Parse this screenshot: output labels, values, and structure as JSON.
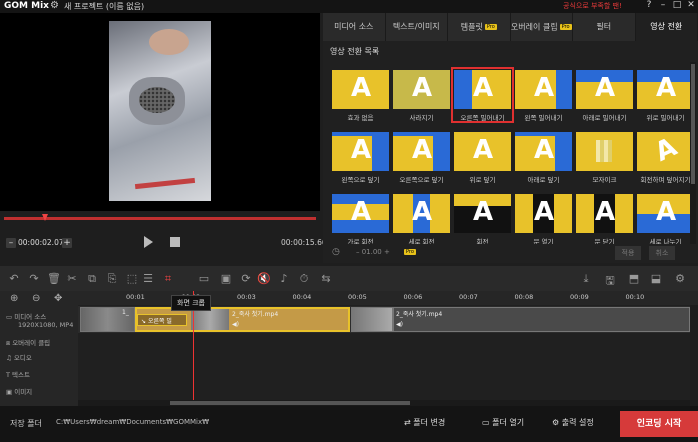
{
  "app": {
    "logo": "GOM Mix",
    "project_name": "새 프로젝트 (이름 없음)",
    "promo": "공식으로 부족할 땐!"
  },
  "window": {
    "help": "?",
    "minimize": "–",
    "maximize": "□",
    "close": "✕"
  },
  "preview": {
    "current_time": "00:00:02.07",
    "end_time": "00:00:15.66",
    "minus": "–",
    "plus": "+"
  },
  "tabs": [
    {
      "label": "미디어 소스",
      "pro": false
    },
    {
      "label": "텍스트/이미지",
      "pro": false
    },
    {
      "label": "템플릿",
      "pro": true
    },
    {
      "label": "오버레이 클립",
      "pro": true
    },
    {
      "label": "필터",
      "pro": false
    },
    {
      "label": "영상 전환",
      "pro": false,
      "active": true
    }
  ],
  "pro_badge": "Pro",
  "section_title": "영상 전환 목록",
  "transitions": [
    "효과 없음",
    "사라지기",
    "오른쪽 밀어내기",
    "왼쪽 밀어내기",
    "아래로 밀어내기",
    "위로 밀어내기",
    "왼쪽으로 덮기",
    "오른쪽으로 덮기",
    "위로 덮기",
    "아래로 덮기",
    "모자이크",
    "회전하며 덮어지기",
    "가로 회전",
    "세로 회전",
    "회전",
    "문 열기",
    "문 닫기",
    "세로 나누기"
  ],
  "transition_panel": {
    "time": "– 01.00 +",
    "apply": "적용",
    "cancel": "취소"
  },
  "timeline": {
    "tooltip": "화면 크롭",
    "ticks": [
      "00:01",
      "00:02",
      "00:03",
      "00:04",
      "00:05",
      "00:06",
      "00:07",
      "00:08",
      "00:09",
      "00:10"
    ],
    "tracks": [
      "미디어 소스",
      "1920X1080, MP4",
      "오버레이 클립",
      "오디오",
      "텍스트",
      "이미지"
    ],
    "clip1_label": "1_",
    "clip2_label": "2_죽사 첫기.mp4",
    "clip2_effect": "오른쪽 밀",
    "clip3_label": "2_죽사 첫기.mp4"
  },
  "status": {
    "save_label": "저장 폴더",
    "save_path": "C:₩Users₩dream₩Documents₩GOMMix₩",
    "change_folder": "폴더 변경",
    "open_folder": "폴더 열기",
    "output_settings": "출력 설정",
    "encode": "인코딩 시작"
  }
}
